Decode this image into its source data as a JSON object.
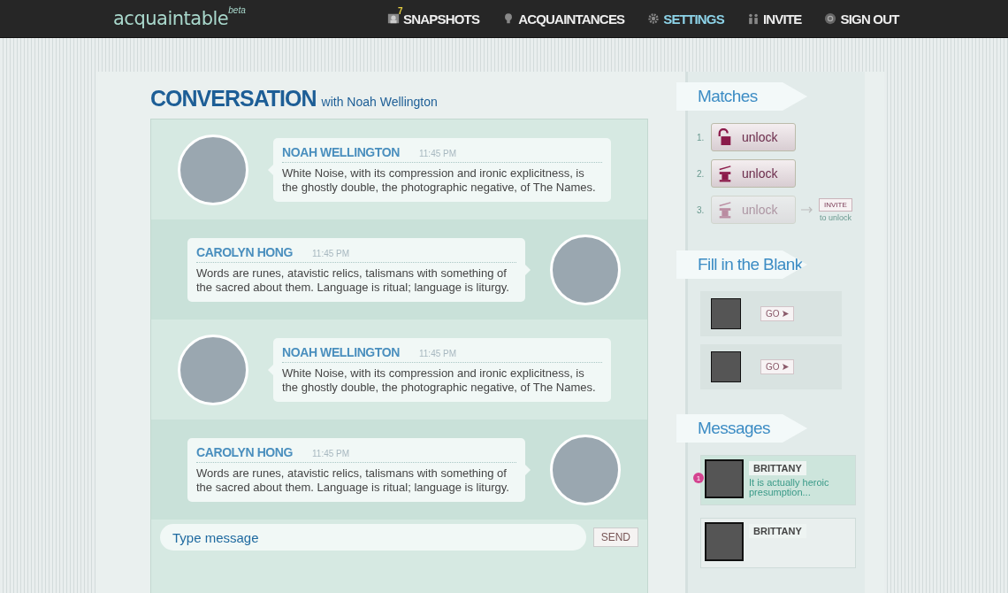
{
  "header": {
    "logo": "acquaintable",
    "logo_tag": "beta",
    "nav": [
      {
        "label": "SNAPSHOTS",
        "badge": "7",
        "selected": false
      },
      {
        "label": "ACQUAINTANCES",
        "selected": false
      },
      {
        "label": "SETTINGS",
        "selected": true
      },
      {
        "label": "INVITE",
        "selected": false
      },
      {
        "label": "SIGN OUT",
        "selected": false
      }
    ]
  },
  "conversation": {
    "title": "CONVERSATION",
    "subtitle": "with Noah Wellington",
    "messages": [
      {
        "kind": "incoming",
        "name": "NOAH WELLINGTON",
        "time": "11:45 PM",
        "text": "White Noise, with its compression and ironic explicitness, is the ghostly double, the photographic negative, of The Names."
      },
      {
        "kind": "outgoing",
        "name": "CAROLYN HONG",
        "time": "11:45 PM",
        "text": "Words are runes, atavistic relics, talismans with something of the sacred about them. Language is ritual; language is liturgy."
      },
      {
        "kind": "incoming",
        "name": "NOAH WELLINGTON",
        "time": "11:45 PM",
        "text": "White Noise, with its compression and ironic explicitness, is the ghostly double, the photographic negative, of The Names."
      },
      {
        "kind": "outgoing",
        "name": "CAROLYN HONG",
        "time": "11:45 PM",
        "text": "Words are runes, atavistic relics, talismans with something of the sacred about them. Language is ritual; language is liturgy."
      }
    ],
    "input": {
      "placeholder": "Type message"
    },
    "send": "SEND"
  },
  "matches": {
    "title": "Matches",
    "items": [
      {
        "number": "1.",
        "kind": "padlock",
        "label": "unlock",
        "disabled": false
      },
      {
        "number": "2.",
        "kind": "hat",
        "label": "unlock",
        "disabled": false
      },
      {
        "number": "3.",
        "kind": "hat",
        "label": "unlock",
        "disabled": true,
        "invite": "INVITE",
        "invite_note": "to unlock"
      }
    ]
  },
  "fill_blank": {
    "title": "Fill in the Blank",
    "items": [
      {
        "button": "GO"
      },
      {
        "button": "GO"
      }
    ]
  },
  "messages": {
    "title": "Messages",
    "items": [
      {
        "name": "BRITTANY",
        "preview": "It is actually heroic presumption...",
        "unread": "1",
        "selected": true
      },
      {
        "name": "BRITTANY",
        "selected": false
      }
    ]
  }
}
